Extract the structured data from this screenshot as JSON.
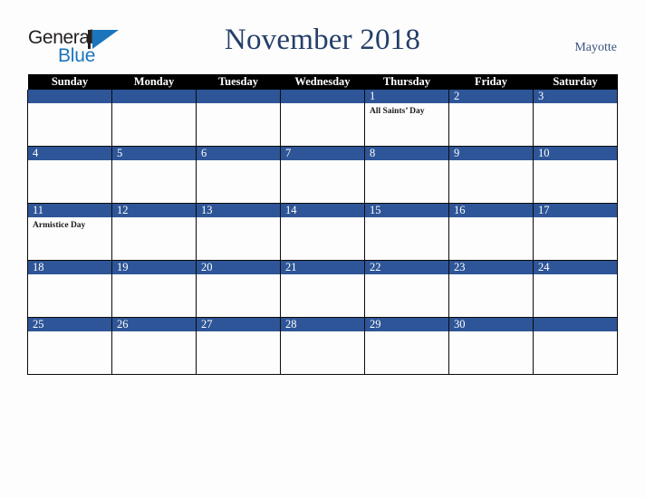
{
  "brand": {
    "name_part1": "General",
    "name_part2": "Blue",
    "mark_icon": "sail-triangle-icon"
  },
  "header": {
    "title": "November 2018",
    "region": "Mayotte"
  },
  "colors": {
    "accent_blue": "#2e5597",
    "header_black": "#000000",
    "title_navy": "#243f69",
    "logo_blue": "#1b75bc",
    "page_background": "#fdfdfd"
  },
  "calendar": {
    "weekday_headers": [
      "Sunday",
      "Monday",
      "Tuesday",
      "Wednesday",
      "Thursday",
      "Friday",
      "Saturday"
    ],
    "weeks": [
      [
        {
          "date": "",
          "events": []
        },
        {
          "date": "",
          "events": []
        },
        {
          "date": "",
          "events": []
        },
        {
          "date": "",
          "events": []
        },
        {
          "date": "1",
          "events": [
            "All Saints’ Day"
          ]
        },
        {
          "date": "2",
          "events": []
        },
        {
          "date": "3",
          "events": []
        }
      ],
      [
        {
          "date": "4",
          "events": []
        },
        {
          "date": "5",
          "events": []
        },
        {
          "date": "6",
          "events": []
        },
        {
          "date": "7",
          "events": []
        },
        {
          "date": "8",
          "events": []
        },
        {
          "date": "9",
          "events": []
        },
        {
          "date": "10",
          "events": []
        }
      ],
      [
        {
          "date": "11",
          "events": [
            "Armistice Day"
          ]
        },
        {
          "date": "12",
          "events": []
        },
        {
          "date": "13",
          "events": []
        },
        {
          "date": "14",
          "events": []
        },
        {
          "date": "15",
          "events": []
        },
        {
          "date": "16",
          "events": []
        },
        {
          "date": "17",
          "events": []
        }
      ],
      [
        {
          "date": "18",
          "events": []
        },
        {
          "date": "19",
          "events": []
        },
        {
          "date": "20",
          "events": []
        },
        {
          "date": "21",
          "events": []
        },
        {
          "date": "22",
          "events": []
        },
        {
          "date": "23",
          "events": []
        },
        {
          "date": "24",
          "events": []
        }
      ],
      [
        {
          "date": "25",
          "events": []
        },
        {
          "date": "26",
          "events": []
        },
        {
          "date": "27",
          "events": []
        },
        {
          "date": "28",
          "events": []
        },
        {
          "date": "29",
          "events": []
        },
        {
          "date": "30",
          "events": []
        },
        {
          "date": "",
          "events": []
        }
      ]
    ]
  }
}
